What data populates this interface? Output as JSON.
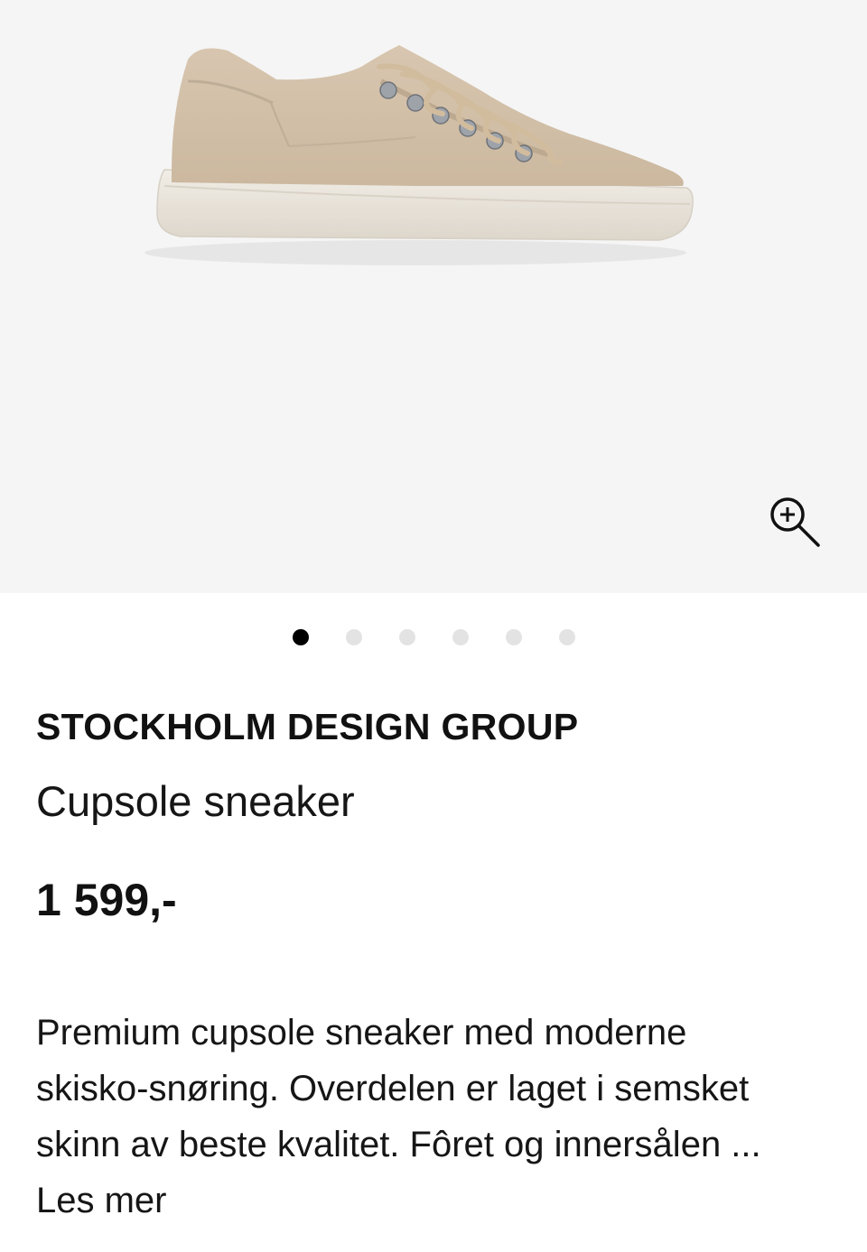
{
  "gallery": {
    "image_alt": "Cupsole sneaker",
    "slide_count": 6,
    "active_slide": 1,
    "zoom_icon": "zoom-in-icon"
  },
  "product": {
    "brand": "STOCKHOLM DESIGN GROUP",
    "name": "Cupsole sneaker",
    "price": "1 599,-"
  },
  "description": {
    "lines": [
      "Premium cupsole sneaker med moderne",
      "skisko-snøring. Overdelen er laget i semsket",
      "skinn av beste kvalitet. Fôret og innersålen ..."
    ],
    "read_more": "Les mer"
  },
  "colors": {
    "gallery_bg": "#f5f5f5",
    "dot_active": "#000000",
    "dot_inactive": "#e3e3e3",
    "shoe_upper": "#d9c7b1",
    "shoe_sole": "#ece7df"
  }
}
